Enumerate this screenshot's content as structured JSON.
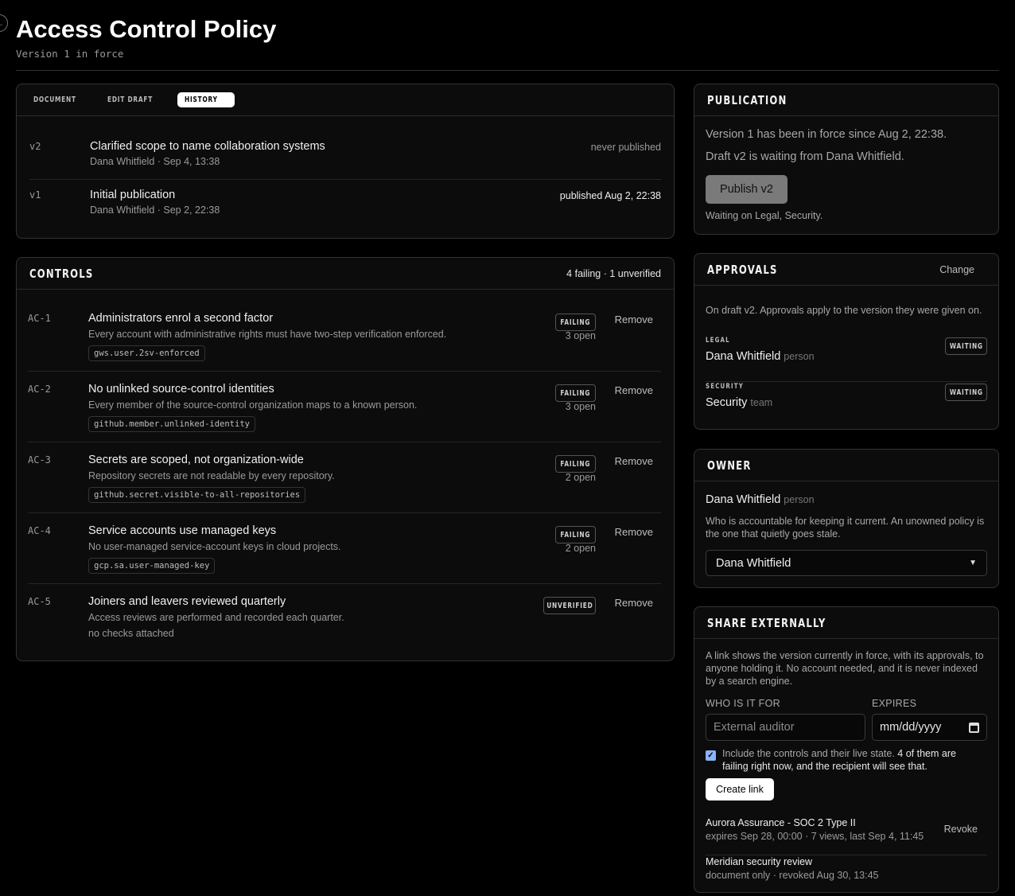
{
  "header": {
    "back_glyph": "←",
    "title": "Access Control Policy",
    "subtitle": "Version 1 in force"
  },
  "history": {
    "tabs": [
      {
        "label": "DOCUMENT",
        "active": false
      },
      {
        "label": "EDIT DRAFT",
        "active": false
      },
      {
        "label": "HISTORY",
        "active": true
      }
    ],
    "rows": [
      {
        "version": "v2",
        "title": "Clarified scope to name collaboration systems",
        "meta": "Dana Whitfield · Sep 4, 13:38",
        "status": "never published"
      },
      {
        "version": "v1",
        "title": "Initial publication",
        "meta": "Dana Whitfield · Sep 2, 22:38",
        "status": "published Aug 2, 22:38"
      }
    ]
  },
  "controls": {
    "title": "CONTROLS",
    "summary": "4 failing · 1 unverified",
    "remove_label": "Remove",
    "items": [
      {
        "id": "AC-1",
        "name": "Administrators enrol a second factor",
        "desc": "Every account with administrative rights must have two-step verification enforced.",
        "check": "gws.user.2sv-enforced",
        "status": "FAILING",
        "open": "3 open"
      },
      {
        "id": "AC-2",
        "name": "No unlinked source-control identities",
        "desc": "Every member of the source-control organization maps to a known person.",
        "check": "github.member.unlinked-identity",
        "status": "FAILING",
        "open": "3 open"
      },
      {
        "id": "AC-3",
        "name": "Secrets are scoped, not organization-wide",
        "desc": "Repository secrets are not readable by every repository.",
        "check": "github.secret.visible-to-all-repositories",
        "status": "FAILING",
        "open": "2 open"
      },
      {
        "id": "AC-4",
        "name": "Service accounts use managed keys",
        "desc": "No user-managed service-account keys in cloud projects.",
        "check": "gcp.sa.user-managed-key",
        "status": "FAILING",
        "open": "2 open"
      },
      {
        "id": "AC-5",
        "name": "Joiners and leavers reviewed quarterly",
        "desc": "Access reviews are performed and recorded each quarter.",
        "no_checks": "no checks attached",
        "status": "UNVERIFIED",
        "open": ""
      }
    ]
  },
  "publication": {
    "title": "PUBLICATION",
    "line1": "Version 1 has been in force since Aug 2, 22:38.",
    "line2": "Draft v2 is waiting from Dana Whitfield.",
    "button": "Publish v2",
    "waiting": "Waiting on Legal, Security."
  },
  "approvals": {
    "title": "APPROVALS",
    "change": "Change",
    "note": "On draft v2. Approvals apply to the version they were given on.",
    "rows": [
      {
        "role": "LEGAL",
        "who": "Dana Whitfield",
        "kind": "person",
        "status": "WAITING"
      },
      {
        "role": "SECURITY",
        "who": "Security",
        "kind": "team",
        "status": "WAITING"
      }
    ]
  },
  "owner": {
    "title": "OWNER",
    "name": "Dana Whitfield",
    "kind": "person",
    "note": "Who is accountable for keeping it current. An unowned policy is the one that quietly goes stale.",
    "select_value": "Dana Whitfield"
  },
  "share": {
    "title": "SHARE EXTERNALLY",
    "note": "A link shows the version currently in force, with its approvals, to anyone holding it. No account needed, and it is never indexed by a search engine.",
    "who_label": "WHO IS IT FOR",
    "who_placeholder": "External auditor",
    "expires_label": "EXPIRES",
    "expires_placeholder": "mm/dd/yyyy",
    "include_label": "Include the controls and their live state.",
    "include_warning": "4 of them are failing right now, and the recipient will see that.",
    "include_checked": true,
    "create_button": "Create link",
    "links": [
      {
        "name": "Aurora Assurance - SOC 2 Type II",
        "meta": "expires Sep 28, 00:00 · 7 views, last Sep 4, 11:45",
        "action": "Revoke"
      },
      {
        "name": "Meridian security review",
        "meta": "document only · revoked Aug 30, 13:45",
        "action": ""
      }
    ]
  }
}
